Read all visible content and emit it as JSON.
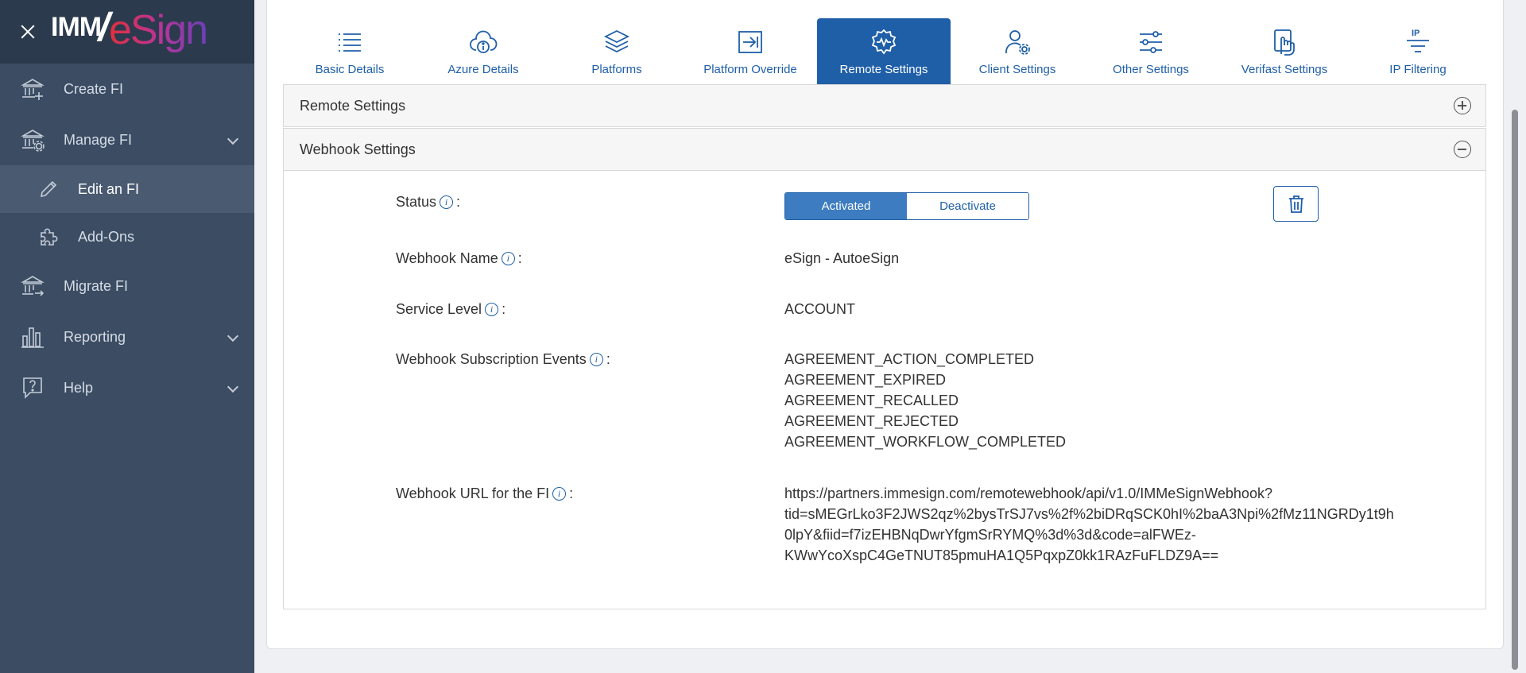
{
  "brand": {
    "left": "IMM",
    "slash": "/",
    "right": "eSign"
  },
  "sidebar": {
    "items": [
      {
        "label": "Create FI",
        "icon": "bank-add-icon"
      },
      {
        "label": "Manage FI",
        "icon": "bank-settings-icon",
        "expandable": true
      },
      {
        "label": "Edit an FI",
        "icon": "pencil-icon",
        "sub": true,
        "active": true
      },
      {
        "label": "Add-Ons",
        "icon": "puzzle-icon",
        "sub": true
      },
      {
        "label": "Migrate FI",
        "icon": "bank-migrate-icon"
      },
      {
        "label": "Reporting",
        "icon": "bar-chart-icon",
        "expandable": true
      },
      {
        "label": "Help",
        "icon": "help-bubble-icon",
        "expandable": true
      }
    ]
  },
  "tabs": [
    {
      "label": "Basic Details",
      "icon": "list-icon"
    },
    {
      "label": "Azure Details",
      "icon": "cloud-info-icon"
    },
    {
      "label": "Platforms",
      "icon": "layers-icon"
    },
    {
      "label": "Platform Override",
      "icon": "arrow-box-icon"
    },
    {
      "label": "Remote Settings",
      "icon": "gear-pulse-icon",
      "active": true
    },
    {
      "label": "Client Settings",
      "icon": "user-gear-icon"
    },
    {
      "label": "Other Settings",
      "icon": "sliders-icon"
    },
    {
      "label": "Verifast Settings",
      "icon": "hand-touch-icon"
    },
    {
      "label": "IP Filtering",
      "icon": "ip-filter-icon"
    }
  ],
  "panels": {
    "remote_settings": {
      "title": "Remote Settings",
      "state": "collapsed"
    },
    "webhook_settings": {
      "title": "Webhook Settings",
      "state": "expanded"
    }
  },
  "webhook": {
    "status_label": "Status",
    "status_options": [
      "Activated",
      "Deactivate"
    ],
    "status_selected": "Activated",
    "name_label": "Webhook Name",
    "name_value": "eSign - AutoeSign",
    "service_level_label": "Service Level",
    "service_level_value": "ACCOUNT",
    "events_label": "Webhook Subscription Events",
    "events": [
      "AGREEMENT_ACTION_COMPLETED",
      "AGREEMENT_EXPIRED",
      "AGREEMENT_RECALLED",
      "AGREEMENT_REJECTED",
      "AGREEMENT_WORKFLOW_COMPLETED"
    ],
    "url_label": "Webhook URL for the FI",
    "url_lines": [
      "https://partners.immesign.com/remotewebhook/api/v1.0/IMMeSignWebhook?",
      "tid=sMEGrLko3F2JWS2qz%2bysTrSJ7vs%2f%2biDRqSCK0hI%2baA3Npi%2fMz11NGRDy1t9h",
      "0lpY&fiid=f7izEHBNqDwrYfgmSrRYMQ%3d%3d&code=alFWEz-",
      "KWwYcoXspC4GeTNUT85pmuHA1Q5PqxpZ0kk1RAzFuFLDZ9A=="
    ],
    "colon": ":"
  },
  "colors": {
    "sidebar": "#3b4c63",
    "brand_bar": "#2c3a4e",
    "primary": "#1f5fa8",
    "active_toggle": "#3d7cc0"
  }
}
